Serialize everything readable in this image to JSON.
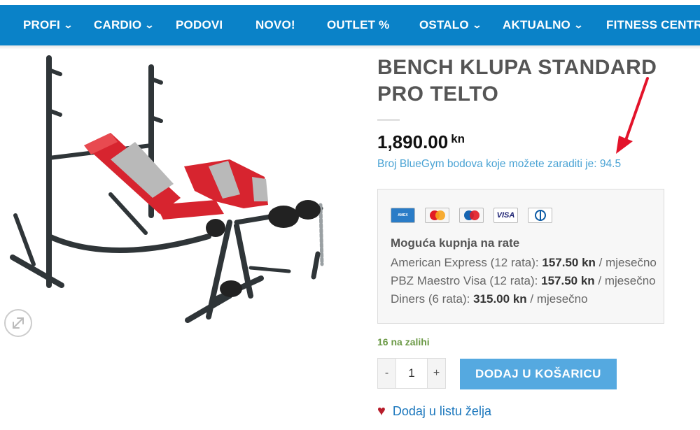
{
  "nav": {
    "items": [
      {
        "label": "PROFI",
        "has_dropdown": true
      },
      {
        "label": "CARDIO",
        "has_dropdown": true
      },
      {
        "label": "PODOVI",
        "has_dropdown": false
      },
      {
        "label": "NOVO!",
        "has_dropdown": false
      },
      {
        "label": "OUTLET %",
        "has_dropdown": false
      },
      {
        "label": "OSTALO",
        "has_dropdown": true
      },
      {
        "label": "AKTUALNO",
        "has_dropdown": true
      },
      {
        "label": "FITNESS CENTRI",
        "has_dropdown": false
      }
    ],
    "color": "#0a82c8"
  },
  "product": {
    "title": "BENCH KLUPA STANDARD PRO TELTO",
    "price": "1,890.00",
    "currency": "kn",
    "points_text": "Broj BlueGym bodova koje možete zaraditi je: 94.5",
    "stock": "16 na zalihi",
    "quantity": "1",
    "qty_minus": "-",
    "qty_plus": "+",
    "add_to_cart": "DODAJ U KOŠARICU",
    "wishlist": "Dodaj u listu želja"
  },
  "installments": {
    "title": "Moguća kupnja na rate",
    "cards": [
      {
        "name": "amex-card-icon",
        "label": "AMERICAN EXPRESS"
      },
      {
        "name": "mastercard-icon",
        "label": "MasterCard"
      },
      {
        "name": "maestro-card-icon",
        "label": "Maestro"
      },
      {
        "name": "visa-card-icon",
        "label": "VISA"
      },
      {
        "name": "diners-card-icon",
        "label": "Diners"
      }
    ],
    "lines": [
      {
        "prefix": "American Express (12 rata): ",
        "amount": "157.50 kn",
        "suffix": " / mjesečno"
      },
      {
        "prefix": "PBZ Maestro Visa (12 rata): ",
        "amount": "157.50 kn",
        "suffix": " / mjesečno"
      },
      {
        "prefix": "Diners (6 rata): ",
        "amount": "315.00 kn",
        "suffix": " / mjesečno"
      }
    ]
  },
  "colors": {
    "accent": "#55a9e0",
    "link": "#1b77bd",
    "stock": "#6c9a47",
    "heart": "#b71c2a"
  }
}
